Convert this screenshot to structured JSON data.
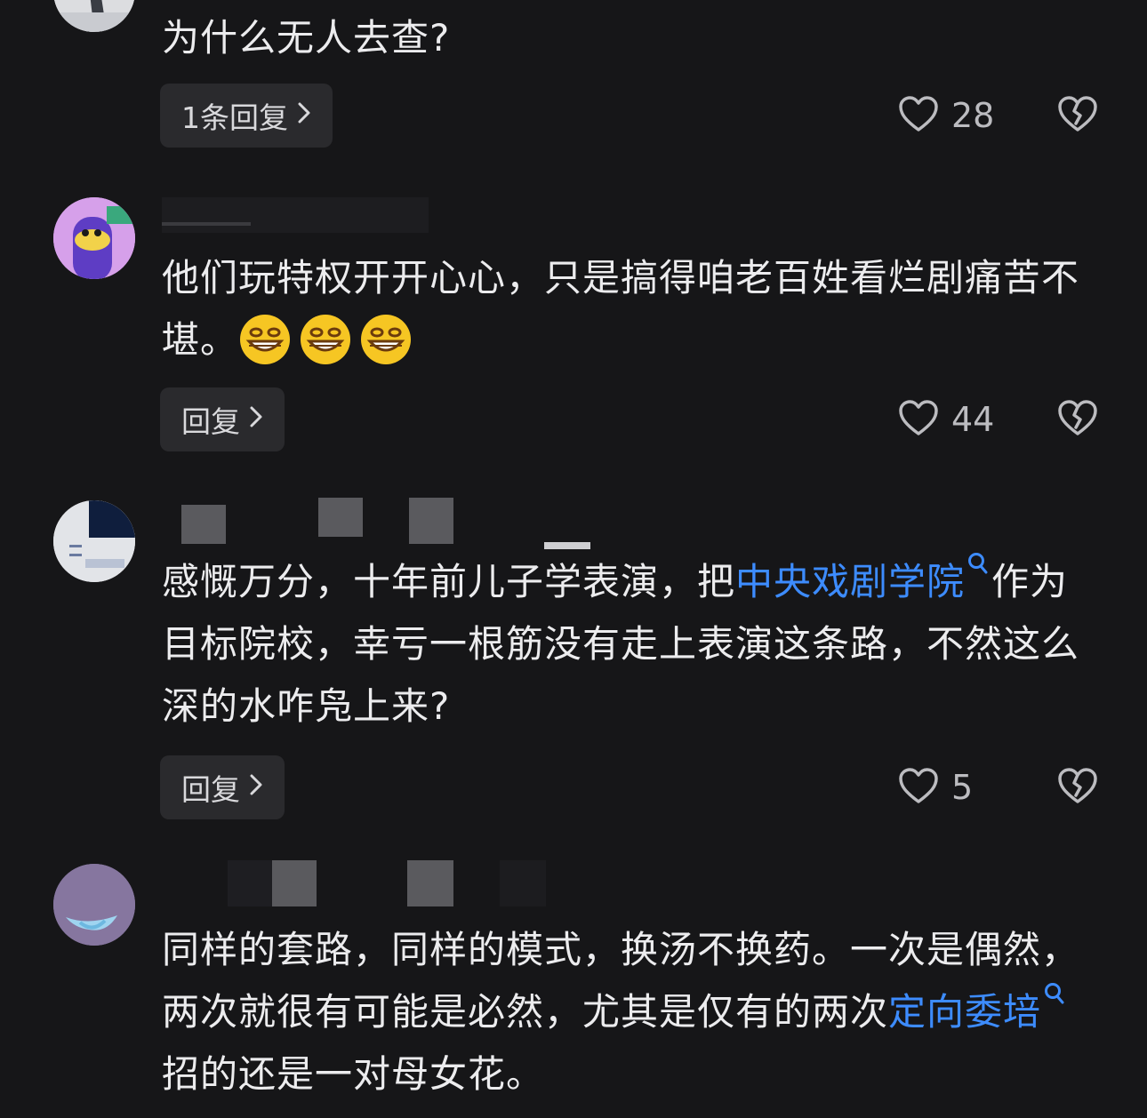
{
  "comments": [
    {
      "text": "为什么无人去查?",
      "reply_label": "1条回复",
      "like_count": "28"
    },
    {
      "text": "他们玩特权开开心心，只是搞得咱老百姓看烂剧痛苦不堪。",
      "emoji": [
        "grinning-face-emoji",
        "grinning-face-emoji",
        "grinning-face-emoji"
      ],
      "reply_label": "回复",
      "like_count": "44"
    },
    {
      "text_before": "感慨万分，十年前儿子学表演，把",
      "link_text": "中央戏剧学院",
      "text_after": "作为目标院校，幸亏一根筋没有走上表演这条路，不然这么深的水咋凫上来?",
      "reply_label": "回复",
      "like_count": "5"
    },
    {
      "text_before": "同样的套路，同样的模式，换汤不换药。一次是偶然，两次就很有可能是必然，尤其是仅有的两次",
      "link_text": "定向委培",
      "text_after": " 招的还是一对母女花。"
    }
  ],
  "colors": {
    "background": "#161618",
    "link": "#3d8cff",
    "reply_button_bg": "#2a2a2d"
  },
  "icons": {
    "reply_chevron": "chevron-right-icon",
    "like": "heart-outline-icon",
    "dislike": "broken-heart-icon",
    "link_search": "search-icon"
  }
}
